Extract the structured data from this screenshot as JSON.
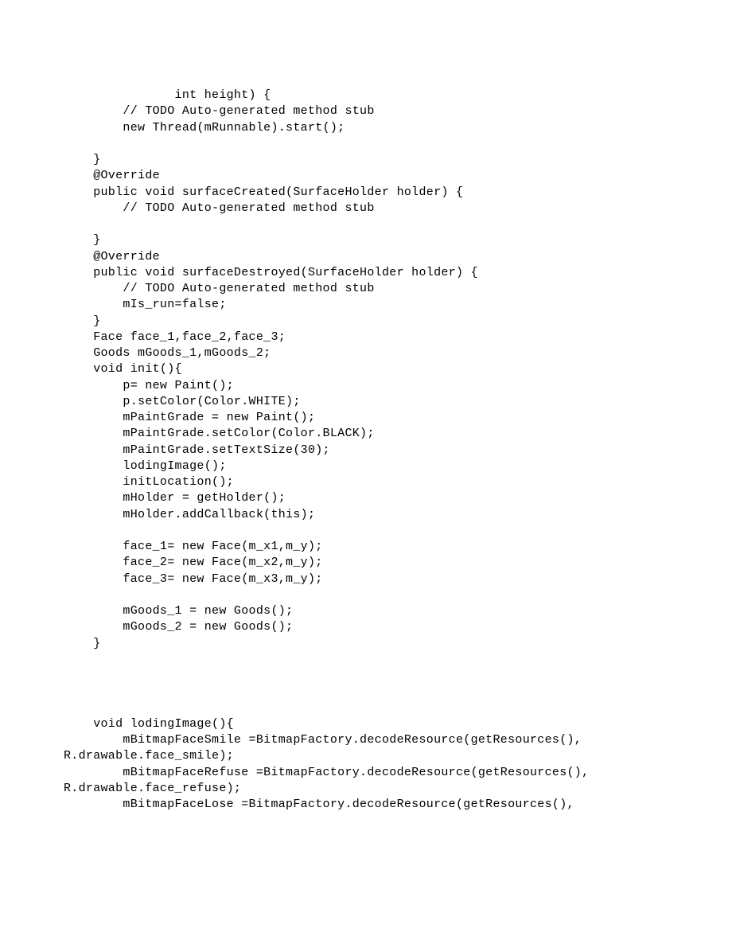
{
  "lines": [
    "               int height) {",
    "        // TODO Auto-generated method stub",
    "        new Thread(mRunnable).start();",
    "",
    "    }",
    "    @Override",
    "    public void surfaceCreated(SurfaceHolder holder) {",
    "        // TODO Auto-generated method stub",
    "",
    "    }",
    "    @Override",
    "    public void surfaceDestroyed(SurfaceHolder holder) {",
    "        // TODO Auto-generated method stub",
    "        mIs_run=false;",
    "    }",
    "    Face face_1,face_2,face_3;",
    "    Goods mGoods_1,mGoods_2;",
    "    void init(){",
    "        p= new Paint();",
    "        p.setColor(Color.WHITE);",
    "        mPaintGrade = new Paint();",
    "        mPaintGrade.setColor(Color.BLACK);",
    "        mPaintGrade.setTextSize(30);",
    "        lodingImage();",
    "        initLocation();",
    "        mHolder = getHolder();",
    "        mHolder.addCallback(this);",
    "",
    "        face_1= new Face(m_x1,m_y);",
    "        face_2= new Face(m_x2,m_y);",
    "        face_3= new Face(m_x3,m_y);",
    "",
    "        mGoods_1 = new Goods();",
    "        mGoods_2 = new Goods();",
    "    }",
    "",
    "",
    "",
    "",
    "    void lodingImage(){",
    "        mBitmapFaceSmile =BitmapFactory.decodeResource(getResources(),",
    "R.drawable.face_smile);",
    "        mBitmapFaceRefuse =BitmapFactory.decodeResource(getResources(),",
    "R.drawable.face_refuse);",
    "        mBitmapFaceLose =BitmapFactory.decodeResource(getResources(),"
  ]
}
